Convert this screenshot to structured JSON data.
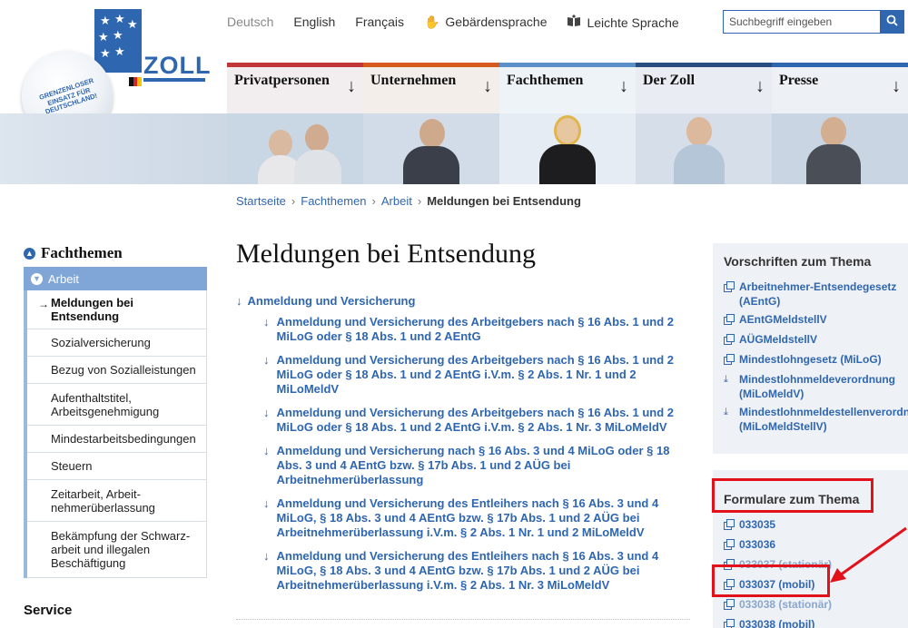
{
  "logo": {
    "wordmark": "ZOLL",
    "circle_text": "GRENZENLOSER EINSATZ FÜR DEUTSCHLAND!",
    "brand_color": "#2f66b0"
  },
  "languages": [
    {
      "label": "Deutsch",
      "active": true
    },
    {
      "label": "English",
      "active": false
    },
    {
      "label": "Français",
      "active": false
    },
    {
      "label": "Gebärdensprache",
      "icon": "sign-language-icon",
      "active": false
    },
    {
      "label": "Leichte Sprache",
      "icon": "easy-language-icon",
      "active": false
    }
  ],
  "search": {
    "placeholder": "Suchbegriff eingeben",
    "icon": "search-icon"
  },
  "main_nav": [
    {
      "label": "Privatpersonen",
      "accent": "#c0373a"
    },
    {
      "label": "Unternehmen",
      "accent": "#d65a1e"
    },
    {
      "label": "Fachthemen",
      "accent": "#5a8fc8"
    },
    {
      "label": "Der Zoll",
      "accent": "#2a4d80"
    },
    {
      "label": "Presse",
      "accent": "#2f66b0"
    }
  ],
  "breadcrumb": {
    "items": [
      "Startseite",
      "Fachthemen",
      "Arbeit"
    ],
    "current": "Meldungen bei Entsendung"
  },
  "sidebar": {
    "title": "Fachthemen",
    "active_section": "Arbeit",
    "items": [
      {
        "label": "Meldungen bei Entsendung",
        "current": true
      },
      {
        "label": "Sozialversicherung"
      },
      {
        "label": "Bezug von Sozialleistungen"
      },
      {
        "label": "Aufenthaltstitel, Arbeitsgenehmigung"
      },
      {
        "label": "Mindestarbeitsbedingungen"
      },
      {
        "label": "Steuern"
      },
      {
        "label": "Zeitarbeit, Arbeit-nehmerüberlassung"
      },
      {
        "label": "Bekämpfung der Schwarz-arbeit und illegalen Beschäftigung"
      }
    ],
    "service_heading": "Service"
  },
  "main": {
    "page_title": "Meldungen bei Entsendung",
    "top_link": "Anmeldung und Versicherung",
    "sub_links": [
      "Anmeldung und Versicherung des Arbeitgebers nach § 16 Abs. 1 und 2 MiLoG oder § 18 Abs. 1 und 2 AEntG",
      "Anmeldung und Versicherung des Arbeitgebers nach § 16 Abs. 1 und 2 MiLoG oder § 18 Abs. 1 und 2 AEntG i.V.m. § 2 Abs. 1 Nr. 1 und 2 MiLoMeldV",
      "Anmeldung und Versicherung des Arbeitgebers nach § 16 Abs. 1 und 2 MiLoG oder § 18 Abs. 1 und 2 AEntG i.V.m. § 2 Abs. 1 Nr. 3 MiLoMeldV",
      "Anmeldung und Versicherung nach § 16 Abs. 3 und 4 MiLoG oder § 18 Abs. 3 und 4 AEntG bzw. § 17b Abs. 1 und 2 AÜG bei Arbeitnehmerüberlassung",
      "Anmeldung und Versicherung des Entleihers nach § 16 Abs. 3 und 4 MiLoG, § 18 Abs. 3 und 4 AEntG bzw. § 17b Abs. 1 und 2 AÜG bei Arbeitnehmerüberlassung i.V.m. § 2 Abs. 1 Nr. 1 und 2 MiLoMeldV",
      "Anmeldung und Versicherung des Entleihers nach § 16 Abs. 3 und 4 MiLoG, § 18 Abs. 3 und 4 AEntG bzw. § 17b Abs. 1 und 2 AÜG bei Arbeitnehmerüberlassung i.V.m. § 2 Abs. 1 Nr. 3 MiLoMeldV"
    ]
  },
  "vorschriften": {
    "title": "Vorschriften zum Thema",
    "links": [
      {
        "label": "Arbeitnehmer-Entsendegesetz (AEntG)",
        "icon": "external-link-icon"
      },
      {
        "label": "AEntGMeldstellV",
        "icon": "external-link-icon"
      },
      {
        "label": "AÜGMeldstellV",
        "icon": "external-link-icon"
      },
      {
        "label": "Mindestlohngesetz (MiLoG)",
        "icon": "external-link-icon"
      },
      {
        "label": "Mindestlohnmeldeverordnung (MiLoMeldV)",
        "icon": "download-icon"
      },
      {
        "label": "Mindestlohnmeldestellenverordnung (MiLoMeldStellV)",
        "icon": "download-icon"
      }
    ]
  },
  "formulare": {
    "title": "Formulare zum Thema",
    "links": [
      {
        "label": "033035"
      },
      {
        "label": "033036"
      },
      {
        "label": "033037 (stationär)"
      },
      {
        "label": "033037 (mobil)"
      },
      {
        "label": "033038 (stationär)"
      },
      {
        "label": "033038 (mobil)"
      }
    ]
  },
  "annotation": {
    "color": "#e3111a"
  }
}
